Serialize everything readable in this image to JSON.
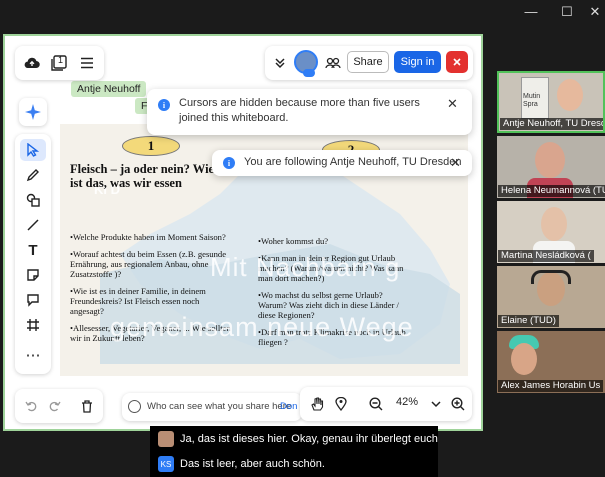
{
  "window_controls": [
    "—",
    "☐",
    "✕"
  ],
  "topbar": {
    "cloud_icon": "cloud-upload-icon",
    "page_count": "1",
    "menu_icon": "hamburger-icon",
    "chevron_icon": "double-chevron-down-icon",
    "share_label": "Share",
    "signin_label": "Sign in",
    "close_icon": "close-icon"
  },
  "cursor_labels": [
    "Antje Neuhoff",
    "F"
  ],
  "toasts": {
    "cursors_hidden": "Cursors are hidden because more than five users joined this whiteboard.",
    "following": "You are following Antje Neuhoff, TU Dresden"
  },
  "toolbar": {
    "tools": [
      "ai-sparkle-icon",
      "select-arrow-icon",
      "pen-icon",
      "shapes-icon",
      "line-icon",
      "text-icon",
      "sticky-note-icon",
      "comment-icon",
      "frame-icon",
      "more-icon"
    ],
    "text_tool": "T",
    "more": "⋯"
  },
  "slide": {
    "circle1": "1",
    "circle2": "2",
    "ki_label": "KI D",
    "headline": "Fleisch  – ja oder nein? Wie wichtig  ist das,  was  wir essen",
    "left_bullets": [
      "Welche Produkte haben im Moment Saison?",
      "Worauf achtest du beim Essen (z.B. gesunde Ernährung, aus regionalem Anbau, ohne Zusatzstoffe  )?",
      "Wie ist es in deiner Familie, in deinem Freundeskreis? Ist Fleisch essen noch angesagt?",
      "Allesesser, Vegetarier, Veganer, ... Wie sollten wir in Zukunft leben?"
    ],
    "right_bullets": [
      "Woher kommst du?",
      "Kann man in deiner Region gut Urlaub machen?  (Warum/warum nicht?     Was kann man dort machen?)",
      "Wo machst du selbst gerne Urlaub? Warum? Was zieht dich in diese Länder / diese Regionen?",
      "Darf man trotz Klimakrise noch in Urlaub fliegen ?"
    ],
    "watermark_1": "Mit Nachbarn g",
    "watermark_2": "gemeinsam neue Wege"
  },
  "bottom_left": {
    "undo_icon": "undo-icon",
    "redo_icon": "redo-icon",
    "trash_icon": "trash-icon"
  },
  "share_hint": {
    "text": "Who can see what you share here",
    "link": "Don"
  },
  "zoom_bar": {
    "hand_icon": "hand-icon",
    "locate_icon": "locate-icon",
    "zoom_out": "−",
    "zoom_level": "42%",
    "zoom_in": "+"
  },
  "participants": [
    {
      "name": "Antje Neuhoff, TU Dresden",
      "overlay": "Mutin Spra",
      "active": true
    },
    {
      "name": "Helena Neumannová (TU)",
      "overlay": "",
      "active": false
    },
    {
      "name": "Martina Nesládková (",
      "overlay": "",
      "active": false
    },
    {
      "name": "Elaine (TUD)",
      "overlay": "",
      "active": false
    },
    {
      "name": "Alex James Horabin Us",
      "overlay": "",
      "active": false
    }
  ],
  "captions": [
    {
      "initials": "",
      "text": "Ja, das ist dieses hier. Okay, genau ihr überlegt euch"
    },
    {
      "initials": "KS",
      "text": "Das ist leer, aber auch schön."
    }
  ],
  "colors": {
    "accent_blue": "#1a66e6",
    "close_red": "#e3312f",
    "active_green": "#52c25a",
    "info_blue": "#2f7df6"
  }
}
